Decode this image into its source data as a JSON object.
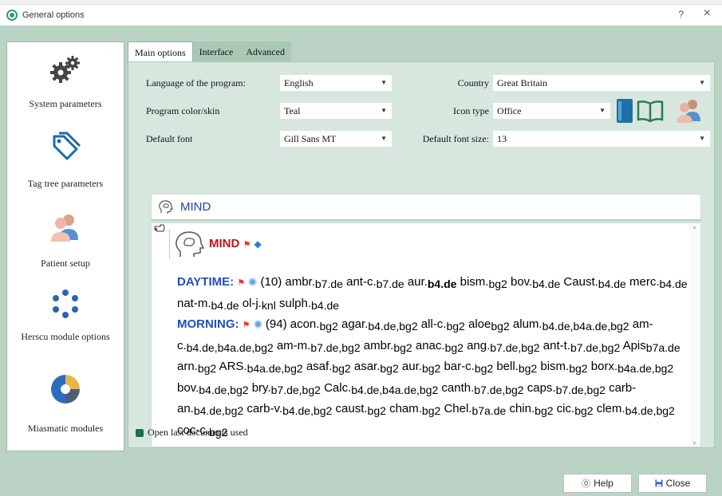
{
  "window": {
    "title": "General options",
    "help": "?",
    "close": "×"
  },
  "sidebar": {
    "items": [
      {
        "label": "System parameters"
      },
      {
        "label": "Tag tree parameters"
      },
      {
        "label": "Patient setup"
      },
      {
        "label": "Herscu module options"
      },
      {
        "label": "Miasmatic modules"
      }
    ]
  },
  "tabs": [
    "Main options",
    "Interface",
    "Advanced"
  ],
  "form": {
    "language": {
      "label": "Language of the program:",
      "value": "English"
    },
    "country": {
      "label": "Country",
      "value": "Great Britain"
    },
    "skin": {
      "label": "Program color/skin",
      "value": "Teal"
    },
    "icon_type": {
      "label": "Icon type",
      "value": "Office"
    },
    "font": {
      "label": "Default font",
      "value": "Gill Sans MT"
    },
    "font_size": {
      "label": "Default font size:",
      "value": "13"
    }
  },
  "viewer": {
    "header_title": "MIND",
    "chapter": "MIND",
    "rubric1": {
      "name": "DAYTIME:",
      "count": "(10)"
    },
    "rubric2": {
      "name": "MORNING:",
      "count": "(94)"
    }
  },
  "open_last_label": "Open last documents used",
  "buttons": {
    "help": "Help",
    "close": "Close"
  },
  "colors": {
    "frame": "#bad3c4",
    "panel": "#d7e7de",
    "rubric": "#1f4fc0",
    "chapter": "#c0141a"
  }
}
